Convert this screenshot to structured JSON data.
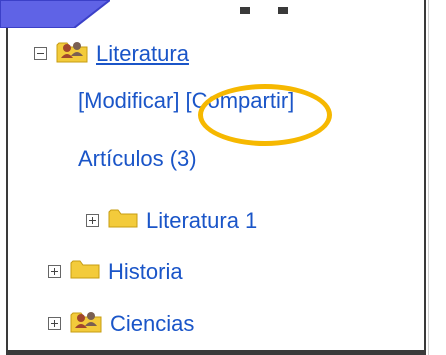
{
  "tree": {
    "root": {
      "label": "Literatura",
      "actions": [
        "[Modificar]",
        "[Compartir]"
      ],
      "articles": "Artículos (3)",
      "children": [
        {
          "label": "Literatura 1"
        }
      ]
    },
    "siblings": [
      {
        "label": "Historia"
      },
      {
        "label": "Ciencias"
      }
    ]
  },
  "icons": {
    "root": "users-folder-icon",
    "child": "folder-icon",
    "sibling_1": "folder-icon",
    "sibling_2": "users-folder-icon"
  },
  "colors": {
    "link": "#1a55c8",
    "highlight": "#f6b800",
    "folder": "#f3cb3b"
  }
}
